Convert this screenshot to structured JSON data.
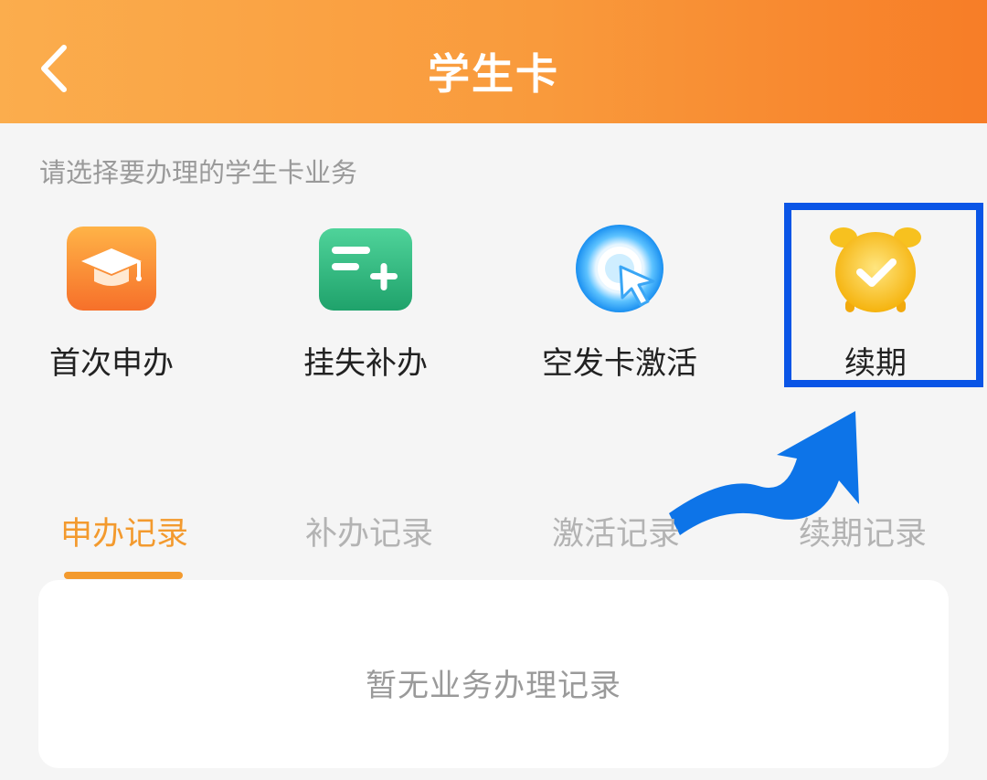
{
  "header": {
    "title": "学生卡",
    "back_icon": "chevron-left-icon"
  },
  "prompt": "请选择要办理的学生卡业务",
  "services": [
    {
      "label": "首次申办",
      "icon": "graduation-cap-icon",
      "color": "#f7862b"
    },
    {
      "label": "挂失补办",
      "icon": "card-add-icon",
      "color": "#26b27a"
    },
    {
      "label": "空发卡激活",
      "icon": "activate-cursor-icon",
      "color": "#1c9ef5"
    },
    {
      "label": "续期",
      "icon": "alarm-clock-icon",
      "color": "#f7bd16"
    }
  ],
  "highlight": {
    "target": "续期",
    "color": "#0a55e6"
  },
  "tabs": [
    {
      "label": "申办记录",
      "active": true
    },
    {
      "label": "补办记录",
      "active": false
    },
    {
      "label": "激活记录",
      "active": false
    },
    {
      "label": "续期记录",
      "active": false
    }
  ],
  "records": {
    "empty_text": "暂无业务办理记录"
  },
  "colors": {
    "accent": "#f39a2e",
    "header_start": "#fbad4d",
    "header_end": "#f77d27"
  }
}
